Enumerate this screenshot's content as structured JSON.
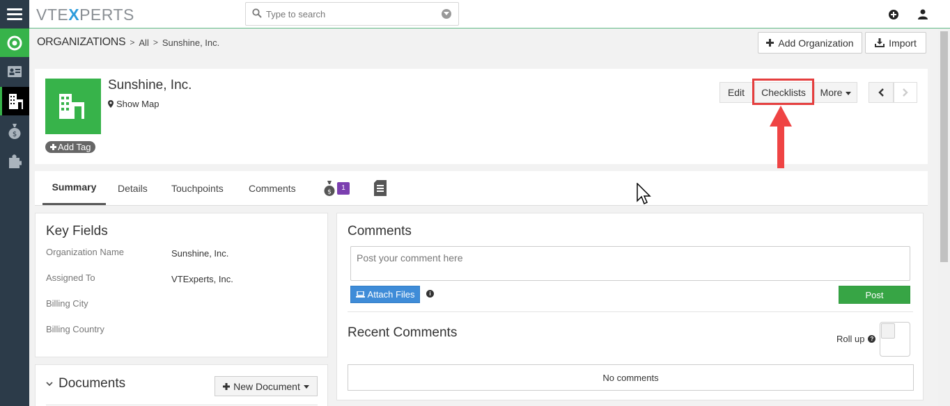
{
  "topbar": {
    "logo_left": "VTE",
    "logo_x": "X",
    "logo_right": "PERTS",
    "search_placeholder": "Type to search"
  },
  "breadcrumb": {
    "module": "ORGANIZATIONS",
    "filter": "All",
    "record": "Sunshine, Inc."
  },
  "actions": {
    "add_organization": "Add Organization",
    "import": "Import"
  },
  "record": {
    "title": "Sunshine, Inc.",
    "show_map": "Show Map",
    "add_tag": "Add Tag",
    "edit": "Edit",
    "checklists": "Checklists",
    "more": "More"
  },
  "tabs": {
    "summary": "Summary",
    "details": "Details",
    "touchpoints": "Touchpoints",
    "comments": "Comments",
    "deals_badge": "1"
  },
  "key_fields": {
    "title": "Key Fields",
    "rows": [
      {
        "label": "Organization Name",
        "value": "Sunshine, Inc."
      },
      {
        "label": "Assigned To",
        "value": "VTExperts, Inc."
      },
      {
        "label": "Billing City",
        "value": ""
      },
      {
        "label": "Billing Country",
        "value": ""
      }
    ]
  },
  "documents": {
    "title": "Documents",
    "new_document": "New Document"
  },
  "comments": {
    "title": "Comments",
    "placeholder": "Post your comment here",
    "attach_files": "Attach Files",
    "info": "i",
    "post": "Post",
    "recent_title": "Recent Comments",
    "roll_up": "Roll up",
    "help": "?",
    "no_comments": "No comments"
  },
  "colors": {
    "sidebar": "#2c3b49",
    "brand_green": "#37b34a",
    "annotation_red": "#e53e3e",
    "attach_blue": "#3f8cd8",
    "badge_purple": "#7b3fb0"
  }
}
